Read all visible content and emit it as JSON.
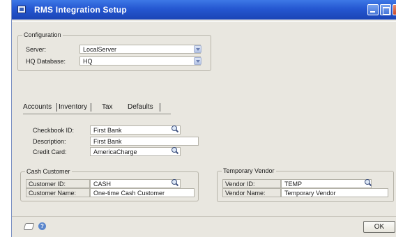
{
  "window": {
    "title": "RMS Integration Setup"
  },
  "configuration": {
    "title": "Configuration",
    "server_label": "Server:",
    "server_value": "LocalServer",
    "hq_label": "HQ Database:",
    "hq_value": "HQ"
  },
  "tabs": [
    {
      "label": "Accounts"
    },
    {
      "label": "Inventory"
    },
    {
      "label": "Tax"
    },
    {
      "label": "Defaults"
    }
  ],
  "accounts": {
    "checkbook_label": "Checkbook ID:",
    "checkbook_value": "First Bank",
    "description_label": "Description:",
    "description_value": "First Bank",
    "credit_label": "Credit Card:",
    "credit_value": "AmericaCharge"
  },
  "cash_customer": {
    "title": "Cash Customer",
    "id_label": "Customer ID:",
    "id_value": "CASH",
    "name_label": "Customer Name:",
    "name_value": "One-time Cash Customer"
  },
  "temp_vendor": {
    "title": "Temporary Vendor",
    "id_label": "Vendor ID:",
    "id_value": "TEMP",
    "name_label": "Vendor Name:",
    "name_value": "Temporary Vendor"
  },
  "footer": {
    "ok_label": "OK",
    "help_glyph": "?"
  },
  "icons": [
    "app-icon",
    "minimize-icon",
    "maximize-icon",
    "close-icon",
    "chevron-down-icon",
    "lookup-icon",
    "note-icon",
    "help-icon"
  ]
}
